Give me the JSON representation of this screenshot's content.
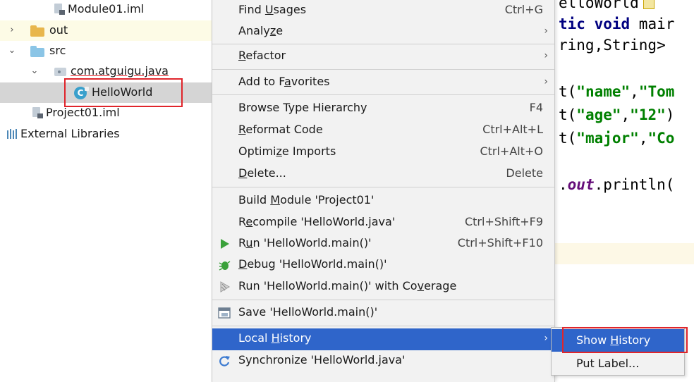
{
  "project_tree": {
    "items": [
      {
        "label": "Module01.iml",
        "icon": "module-file-icon"
      },
      {
        "label": "out",
        "icon": "folder-icon"
      },
      {
        "label": "src",
        "icon": "source-folder-icon"
      },
      {
        "label": "com.atguigu.java",
        "icon": "package-icon"
      },
      {
        "label": "HelloWorld",
        "icon": "java-class-icon",
        "class_letter": "C"
      },
      {
        "label": "Project01.iml",
        "icon": "module-file-icon"
      },
      {
        "label": "External Libraries",
        "icon": "libraries-icon"
      }
    ]
  },
  "context_menu": {
    "items": [
      {
        "label": "Find Usages",
        "shortcut": "Ctrl+G"
      },
      {
        "label": "Analyze",
        "submenu": true
      },
      {
        "label": "Refactor",
        "submenu": true
      },
      {
        "label": "Add to Favorites",
        "submenu": true
      },
      {
        "label": "Browse Type Hierarchy",
        "shortcut": "F4"
      },
      {
        "label": "Reformat Code",
        "shortcut": "Ctrl+Alt+L"
      },
      {
        "label": "Optimize Imports",
        "shortcut": "Ctrl+Alt+O"
      },
      {
        "label": "Delete...",
        "shortcut": "Delete"
      },
      {
        "label": "Build Module 'Project01'"
      },
      {
        "label": "Recompile 'HelloWorld.java'",
        "shortcut": "Ctrl+Shift+F9"
      },
      {
        "label": "Run 'HelloWorld.main()'",
        "shortcut": "Ctrl+Shift+F10",
        "icon": "run-icon"
      },
      {
        "label": "Debug 'HelloWorld.main()'",
        "icon": "debug-icon"
      },
      {
        "label": "Run 'HelloWorld.main()' with Coverage",
        "icon": "coverage-icon"
      },
      {
        "label": "Save 'HelloWorld.main()'",
        "icon": "save-config-icon"
      },
      {
        "label": "Local History",
        "submenu": true,
        "active": true
      },
      {
        "label": "Synchronize 'HelloWorld.java'",
        "icon": "sync-icon"
      }
    ]
  },
  "local_history_submenu": {
    "items": [
      {
        "label": "Show History",
        "active": true
      },
      {
        "label": "Put Label..."
      }
    ]
  },
  "editor": {
    "lines": [
      {
        "text": "elloWorld"
      },
      {
        "kw": "tic void ",
        "plain": "mair"
      },
      {
        "plain": "ring,String>"
      },
      {
        "pre": "t(",
        "str": "\"name\"",
        "mid": ",",
        "str2": "\"Tom"
      },
      {
        "pre": "t(",
        "str": "\"age\"",
        "mid": ",",
        "str2": "\"12\"",
        "post": ")"
      },
      {
        "pre": "t(",
        "str": "\"major\"",
        "mid": ",",
        "str2": "\"Co"
      },
      {
        "pre": ".",
        "fld": "out",
        "post": ".println("
      }
    ]
  },
  "colors": {
    "selection_blue": "#2f65ca",
    "highlight_red": "#e0252b",
    "string_green": "#008000",
    "keyword_navy": "#000080"
  }
}
